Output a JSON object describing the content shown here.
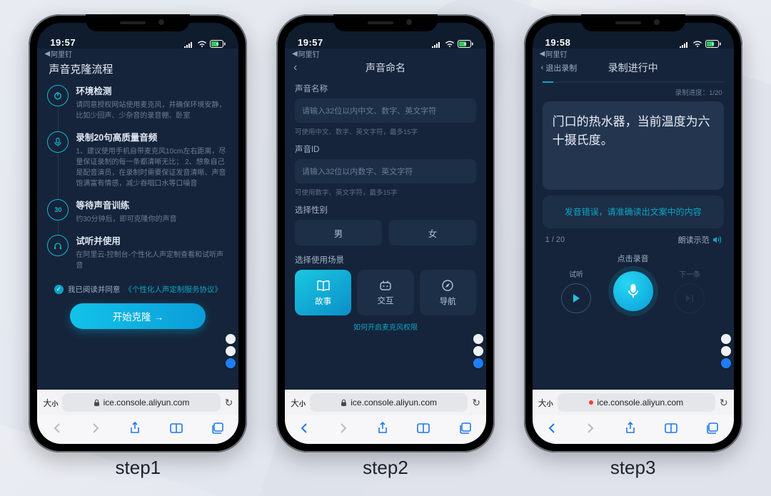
{
  "status": {
    "time_a": "19:57",
    "time_b": "19:57",
    "time_c": "19:58",
    "back_app": "阿里钉"
  },
  "labels": {
    "step1": "step1",
    "step2": "step2",
    "step3": "step3"
  },
  "s1": {
    "title": "声音克隆流程",
    "steps": [
      {
        "h": "环境检测",
        "p": "请同意授权网站使用麦克风，并确保环境安静，比如少回声、少杂音的录音棚、卧室"
      },
      {
        "h": "录制20句高质量音频",
        "p": "1、建议使用手机自带麦克风10cm左右距离，尽量保证录制的每一条都清晰无比；\n2、想象自己是配音演员，在录制时需要保证发音清晰、声音饱满富有情感，减少吞咽口水等口噪音"
      },
      {
        "h": "等待声音训练",
        "p": "约30分钟后，即可克隆你的声音"
      },
      {
        "h": "试听并使用",
        "p": "在阿里云-控制台-个性化人声定制查看和试听声音"
      }
    ],
    "step3_icon_text": "30",
    "consent_pre": "我已阅读并同意",
    "consent_link": "《个性化人声定制服务协议》",
    "cta": "开始克隆 →"
  },
  "s2": {
    "nav_title": "声音命名",
    "name_label": "声音名称",
    "name_placeholder": "请输入32位以内中文、数字、英文字符",
    "name_hint": "可使用中文、数字、英文字符，最多15字",
    "id_label": "声音ID",
    "id_placeholder": "请输入32位以内数字、英文字符",
    "id_hint": "可使用数字、英文字符，最多15字",
    "gender_label": "选择性别",
    "gender_m": "男",
    "gender_f": "女",
    "scene_label": "选择使用场景",
    "scene_story": "故事",
    "scene_interact": "交互",
    "scene_nav": "导航",
    "mic_link": "如何开启麦克风权限"
  },
  "s3": {
    "exit": "退出录制",
    "nav_title": "录制进行中",
    "progress_label": "录制进度：",
    "progress_val": "1/20",
    "sentence": "门口的热水器，当前温度为六十摄氏度。",
    "error": "发音错误，请准确读出文案中的内容",
    "counter": "1 / 20",
    "demo": "朗读示范",
    "preview": "试听",
    "record": "点击录音",
    "next": "下一条"
  },
  "safari": {
    "url": "ice.console.aliyun.com",
    "aa_large": "大",
    "aa_small": "小"
  }
}
